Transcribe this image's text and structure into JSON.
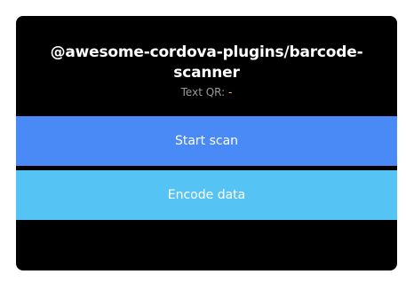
{
  "app": {
    "title": "@awesome-cordova-plugins/barcode-scanner",
    "qr_label": "Text QR:",
    "qr_value": "-"
  },
  "buttons": {
    "start_scan": "Start scan",
    "encode_data": "Encode data"
  },
  "colors": {
    "background": "#000000",
    "start_scan_bg": "#4a8af7",
    "encode_data_bg": "#55c4f5",
    "qr_value": "#f5c518"
  }
}
